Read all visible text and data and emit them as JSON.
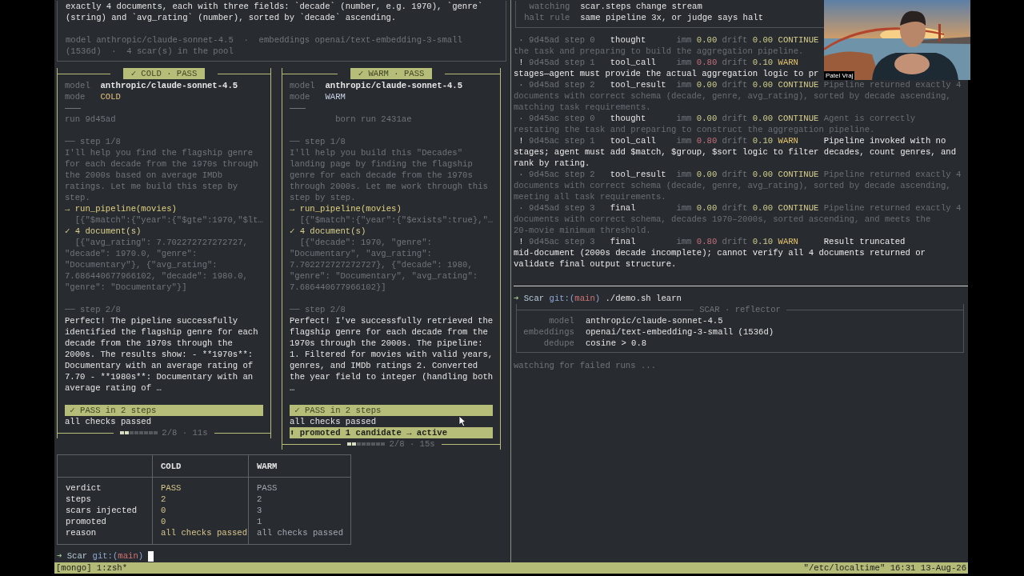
{
  "task_box": {
    "text": "exactly 4 documents, each with three fields: `decade` (number, e.g. 1970), `genre` (string) and `avg_rating` (number), sorted by `decade` ascending.",
    "meta": "model anthropic/claude-sonnet-4.5  ·  embeddings openai/text-embedding-3-small (1536d)  ·  4 scar(s) in the pool"
  },
  "runs": [
    {
      "kind": "cold",
      "badge": "✓ COLD · PASS",
      "model_label": "model",
      "model": "anthropic/claude-sonnet-4.5",
      "mode_label": "mode",
      "mode": "COLD",
      "run": "run 9d45ad",
      "steps": [
        {
          "kind": "intermediate",
          "label": "── step 1/8",
          "text": "I'll help you find the flagship genre for each decade from the 1970s through the 2000s based on average IMDb ratings. Let me build this step by step.",
          "tool": {
            "call": "→ run_pipeline(movies)",
            "args": "[{\"$match\":{\"year\":{\"$gte\":1970,\"$lt…",
            "result": "✓ 4 document(s)",
            "output": "[{\"avg_rating\": 7.702272727272727, \"decade\": 1970.0, \"genre\": \"Documentary\"}, {\"avg_rating\": 7.686440677966102, \"decade\": 1980.0, \"genre\": \"Documentary\"}]"
          }
        },
        {
          "kind": "final",
          "label": "── step 2/8",
          "text": "Perfect! The pipeline successfully identified the flagship genre for each decade from the 1970s through the 2000s. The results show: - **1970s**: Documentary with an average rating of 7.70 - **1980s**: Documentary with an average rating of …"
        }
      ],
      "verdict": "✓ PASS in 2 steps",
      "reason": "all checks passed",
      "progress": {
        "level": 0.25,
        "text": "2/8 · 11s"
      }
    },
    {
      "kind": "warm",
      "badge": "✓ WARM · PASS",
      "model_label": "model",
      "model": "anthropic/claude-sonnet-4.5",
      "mode_label": "mode",
      "mode": "WARM",
      "run": "born run 2431ae",
      "steps": [
        {
          "kind": "intermediate",
          "label": "── step 1/8",
          "text": "I'll help you build this \"Decades\" landing page by finding the flagship genre for each decade from the 1970s through 2000s. Let me work through this step by step.",
          "tool": {
            "call": "→ run_pipeline(movies)",
            "args": "[{\"$match\":{\"year\":{\"$exists\":true},\"…",
            "result": "✓ 4 document(s)",
            "output": "[{\"decade\": 1970, \"genre\": \"Documentary\", \"avg_rating\": 7.702272727272727}, {\"decade\": 1980, \"genre\": \"Documentary\", \"avg_rating\": 7.686440677966102}]"
          }
        },
        {
          "kind": "final",
          "label": "── step 2/8",
          "text": "Perfect! I've successfully retrieved the flagship genre for each decade from the 1970s through the 2000s. The pipeline: 1. Filtered for movies with valid years, genres, and IMDb ratings 2. Converted the year field to integer (handling both …"
        }
      ],
      "verdict": "✓ PASS in 2 steps",
      "reason": "all checks passed",
      "promoted": "⬆ promoted 1 candidate → active",
      "progress": {
        "level": 0.25,
        "text": "2/8 · 15s"
      }
    }
  ],
  "table": {
    "columns": [
      "COLD",
      "WARM"
    ],
    "rows": [
      {
        "label": "verdict",
        "values": [
          "PASS",
          "PASS"
        ]
      },
      {
        "label": "steps",
        "values": [
          "2",
          "2"
        ]
      },
      {
        "label": "scars injected",
        "values": [
          "0",
          "3"
        ]
      },
      {
        "label": "promoted",
        "values": [
          "0",
          "1"
        ]
      },
      {
        "label": "reason",
        "values": [
          "all checks passed",
          "all checks passed"
        ]
      }
    ]
  },
  "bottom_prompt": {
    "arrow": "➜",
    "dir": "Scar",
    "git": "git:(",
    "branch": "main",
    "close": ")"
  },
  "watch_box": {
    "rows": [
      {
        "label": "watching",
        "value": "scar.steps change stream"
      },
      {
        "label": "halt rule",
        "value": "same pipeline 3x, or judge says halt"
      }
    ]
  },
  "log": [
    {
      "kind": "ok",
      "marker": "·",
      "run": "9d45ad",
      "step": "step 0",
      "event": "thought",
      "imm": {
        "label": "imm",
        "value": "0.00"
      },
      "drift": {
        "label": "drift",
        "value": "0.00"
      },
      "verdict": "CONTINUE",
      "wrap": [
        "the task and preparing to build the aggregation pipeline."
      ]
    },
    {
      "kind": "warn",
      "marker": "!",
      "run": "9d45ad",
      "step": "step 1",
      "event": "tool_call",
      "imm": {
        "label": "imm",
        "value": "0.80"
      },
      "drift": {
        "label": "drift",
        "value": "0.10"
      },
      "verdict": "WARN",
      "wrap": [
        "stages—agent must provide the actual aggregation logic to pr"
      ]
    },
    {
      "kind": "ok",
      "marker": "·",
      "run": "9d45ad",
      "step": "step 2",
      "event": "tool_result",
      "imm": {
        "label": "imm",
        "value": "0.00"
      },
      "drift": {
        "label": "drift",
        "value": "0.00"
      },
      "verdict": "CONTINUE",
      "reason": "Pipeline returned exactly 4",
      "wrap": [
        "documents with correct schema (decade, genre, avg_rating), sorted by decade ascending,",
        "matching task requirements."
      ]
    },
    {
      "kind": "ok",
      "marker": "·",
      "run": "9d45ac",
      "step": "step 0",
      "event": "thought",
      "imm": {
        "label": "imm",
        "value": "0.00"
      },
      "drift": {
        "label": "drift",
        "value": "0.00"
      },
      "verdict": "CONTINUE",
      "reason": "Agent is correctly",
      "wrap": [
        "restating the task and preparing to construct the aggregation pipeline."
      ]
    },
    {
      "kind": "warn",
      "marker": "!",
      "run": "9d45ac",
      "step": "step 1",
      "event": "tool_call",
      "imm": {
        "label": "imm",
        "value": "0.80"
      },
      "drift": {
        "label": "drift",
        "value": "0.10"
      },
      "verdict": "WARN",
      "reason": "Pipeline invoked with no",
      "wrap": [
        "stages; agent must add $match, $group, $sort logic to filter decades, count genres, and",
        "rank by rating."
      ]
    },
    {
      "kind": "ok",
      "marker": "·",
      "run": "9d45ac",
      "step": "step 2",
      "event": "tool_result",
      "imm": {
        "label": "imm",
        "value": "0.00"
      },
      "drift": {
        "label": "drift",
        "value": "0.00"
      },
      "verdict": "CONTINUE",
      "reason": "Pipeline returned exactly 4",
      "wrap": [
        "documents with correct schema (decade, genre, avg_rating), sorted by decade ascending,",
        "meeting all task requirements."
      ]
    },
    {
      "kind": "ok",
      "marker": "·",
      "run": "9d45ad",
      "step": "step 3",
      "event": "final",
      "imm": {
        "label": "imm",
        "value": "0.00"
      },
      "drift": {
        "label": "drift",
        "value": "0.00"
      },
      "verdict": "CONTINUE",
      "reason": "Pipeline returned exactly 4",
      "wrap": [
        "documents with correct schema, decades 1970–2000s, sorted ascending, and meets the",
        "20-movie minimum threshold."
      ]
    },
    {
      "kind": "warn",
      "marker": "!",
      "run": "9d45ac",
      "step": "step 3",
      "event": "final",
      "imm": {
        "label": "imm",
        "value": "0.80"
      },
      "drift": {
        "label": "drift",
        "value": "0.10"
      },
      "verdict": "WARN",
      "reason": "Result truncated",
      "wrap": [
        "mid-document (2000s decade incomplete); cannot verify all 4 documents returned or",
        "validate final output structure."
      ]
    }
  ],
  "right_prompt": {
    "arrow": "➜",
    "dir": "Scar",
    "git": "git:(",
    "branch": "main",
    "close": ")",
    "command": "./demo.sh learn"
  },
  "reflector": {
    "title": "SCAR · reflector",
    "rows": [
      {
        "label": "model",
        "value": "anthropic/claude-sonnet-4.5"
      },
      {
        "label": "embeddings",
        "value": "openai/text-embedding-3-small (1536d)"
      },
      {
        "label": "dedupe",
        "value": "cosine > 0.8"
      }
    ],
    "status": "watching for failed runs ..."
  },
  "status_bar": {
    "left": "[mongo] 1:zsh*",
    "right": "\"/etc/localtime\" 16:31 13-Aug-26"
  },
  "video": {
    "name": "Patel Vraj"
  }
}
